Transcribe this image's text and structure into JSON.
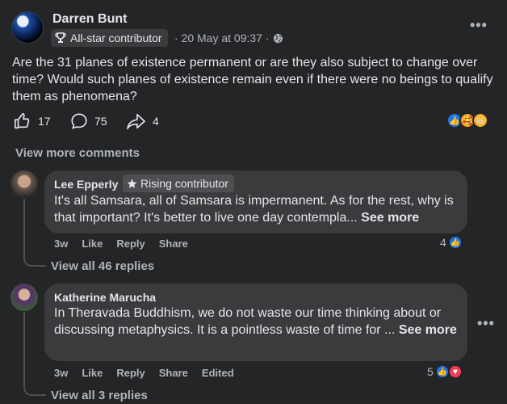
{
  "post": {
    "author": "Darren Bunt",
    "badge": "All-star contributor",
    "meta": "· 20 May at 09:37 ·",
    "text": "Are the 31 planes of existence permanent or are they also subject to change over time?  Would such planes of existence remain even if there were no beings to qualify them as phenomena?",
    "likes": "17",
    "comments": "75",
    "shares": "4"
  },
  "view_more_comments": "View more comments",
  "comments": [
    {
      "author": "Lee Epperly",
      "badge": "Rising contributor",
      "text": "It's all Samsara, all of Samsara is impermanent. As for the rest, why is that important? It's better to live one day contempla...",
      "see_more": "See more",
      "time": "3w",
      "like": "Like",
      "reply": "Reply",
      "share": "Share",
      "reaction_count": "4",
      "view_replies": "View all 46 replies"
    },
    {
      "author": "Katherine Marucha",
      "text": "In Theravada Buddhism, we do not waste our time thinking about or discussing metaphysics. It is a pointless waste of time for ...",
      "see_more": "See more",
      "time": "3w",
      "like": "Like",
      "reply": "Reply",
      "share": "Share",
      "edited": "Edited",
      "reaction_count": "5",
      "view_replies": "View all 3 replies"
    }
  ],
  "icons": [
    "trophy-icon",
    "globe-icon",
    "like-icon",
    "comment-icon",
    "share-icon",
    "more-icon",
    "star-icon"
  ],
  "colors": {
    "background": "#242526",
    "bubble": "#3a3b3c",
    "like_blue": "#1877f2",
    "love_red": "#f33e58"
  }
}
